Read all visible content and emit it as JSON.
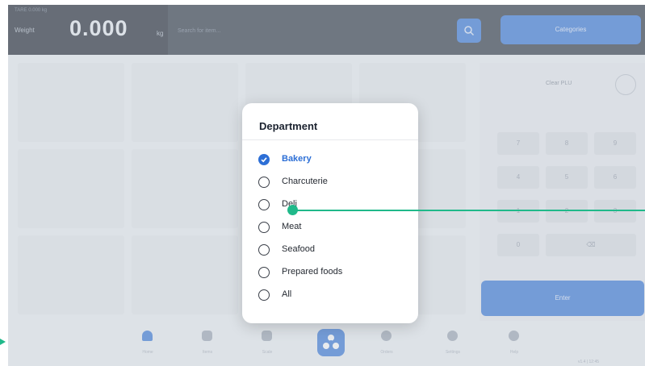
{
  "topbar": {
    "weight_caption": "TARE 0.000 kg",
    "weight_label": "Weight",
    "weight_value": "0.000",
    "weight_unit": "kg",
    "search_placeholder": "Search for item...",
    "categories_label": "Categories"
  },
  "keypad": {
    "clear_label": "Clear PLU",
    "keys": [
      "7",
      "8",
      "9",
      "4",
      "5",
      "6",
      "1",
      "2",
      "3",
      "0",
      "⌫"
    ],
    "enter_label": "Enter"
  },
  "bottom_nav": [
    "Home",
    "Items",
    "Scale",
    "Orders",
    "Settings",
    "Help"
  ],
  "status_text": "v1.4 | 12:45",
  "modal": {
    "title": "Department",
    "options": [
      {
        "label": "Bakery",
        "selected": true
      },
      {
        "label": "Charcuterie",
        "selected": false
      },
      {
        "label": "Deli",
        "selected": false
      },
      {
        "label": "Meat",
        "selected": false
      },
      {
        "label": "Seafood",
        "selected": false
      },
      {
        "label": "Prepared foods",
        "selected": false
      },
      {
        "label": "All",
        "selected": false
      }
    ]
  },
  "colors": {
    "accent": "#2d6fd6",
    "annotation": "#20b98a",
    "topbar": "#232c3a"
  }
}
